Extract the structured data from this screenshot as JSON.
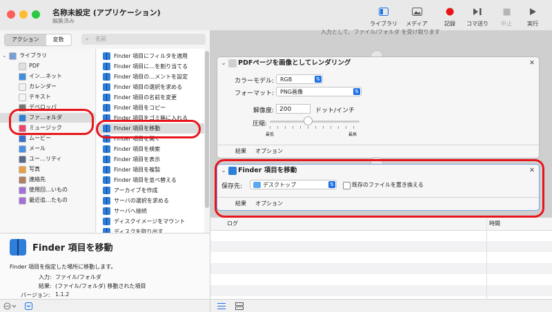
{
  "window": {
    "title": "名称未設定 (アプリケーション)",
    "subtitle": "編集済み"
  },
  "toolbar": {
    "library": "ライブラリ",
    "media": "メディア",
    "record": "記録",
    "step": "コマ送り",
    "stop": "中止",
    "run": "実行"
  },
  "leftpane": {
    "tab_actions": "アクション",
    "tab_variables": "変数",
    "search_placeholder": "名前"
  },
  "categories": [
    {
      "label": "ライブラリ",
      "color": "#7a9fd8"
    },
    {
      "label": "PDF",
      "color": "#e0e0e0"
    },
    {
      "label": "イン…ネット",
      "color": "#3f8fe0"
    },
    {
      "label": "カレンダー",
      "color": "#f0f0f0"
    },
    {
      "label": "テキスト",
      "color": "#f5f5f5"
    },
    {
      "label": "デベロッパ",
      "color": "#777777"
    },
    {
      "label": "ファ…ォルダ",
      "color": "#2f7fd8"
    },
    {
      "label": "ミュージック",
      "color": "#f0456a"
    },
    {
      "label": "ムービー",
      "color": "#3a6fd0"
    },
    {
      "label": "メール",
      "color": "#4a90e8"
    },
    {
      "label": "ユー…リティ",
      "color": "#5a6a8a"
    },
    {
      "label": "写真",
      "color": "#e8a040"
    },
    {
      "label": "連絡先",
      "color": "#b08060"
    },
    {
      "label": "使用回…いもの",
      "color": "#a370d8"
    },
    {
      "label": "最近追…たもの",
      "color": "#a370d8"
    }
  ],
  "actions": [
    "Finder 項目にフィルタを適用",
    "Finder 項目に…を割り当てる",
    "Finder 項目の…メントを設定",
    "Finder 項目の選択を求める",
    "Finder 項目の名前を変更",
    "Finder 項目をコピー",
    "Finder 項目をゴミ箱に入れる",
    "Finder 項目を移動",
    "Finder 項目を開く",
    "Finder 項目を検索",
    "Finder 項目を表示",
    "Finder 項目を複製",
    "Finder 項目を並べ替える",
    "アーカイブを作成",
    "サーバの選択を求める",
    "サーバへ接続",
    "ディスクイメージをマウント",
    "ディスクを取り出す"
  ],
  "description": {
    "title": "Finder 項目を移動",
    "text": "Finder 項目を指定した場所に移動します。",
    "input_label": "入力:",
    "input_value": "ファイル/フォルダ",
    "result_label": "結果:",
    "result_value": "(ファイル/フォルダ) 移動された項目",
    "version_label": "バージョン:",
    "version_value": "1.1.2"
  },
  "workflow": {
    "top_fragment": "入力として、ファイル/フォルダ を受け取ります",
    "pdf_card": {
      "title": "PDFページを画像としてレンダリング",
      "color_model_label": "カラーモデル:",
      "color_model_value": "RGB",
      "format_label": "フォーマット:",
      "format_value": "PNG画像",
      "resolution_label": "解像度:",
      "resolution_value": "200",
      "resolution_unit": "ドット/インチ",
      "compression_label": "圧縮:",
      "min_label": "最低",
      "max_label": "最高",
      "tab_results": "結果",
      "tab_options": "オプション"
    },
    "move_card": {
      "title": "Finder 項目を移動",
      "dest_label": "保存先:",
      "dest_value": "デスクトップ",
      "replace_label": "既存のファイルを置き換える",
      "tab_results": "結果",
      "tab_options": "オプション"
    }
  },
  "log": {
    "col_log": "ログ",
    "col_time": "時間"
  },
  "colors": {
    "highlight": "#e8141a",
    "accent": "#1d6fe8"
  }
}
